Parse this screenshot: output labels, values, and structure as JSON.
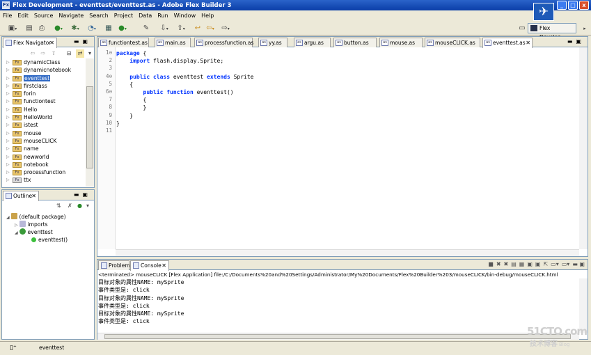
{
  "window": {
    "title": "Flex Development - eventtest/eventtest.as - Adobe Flex Builder 3",
    "app_icon": "Fx",
    "controls": [
      "_",
      "□",
      "x"
    ]
  },
  "menu": [
    "File",
    "Edit",
    "Source",
    "Navigate",
    "Search",
    "Project",
    "Data",
    "Run",
    "Window",
    "Help"
  ],
  "logo_glyph": "✈",
  "perspective": {
    "label": "Flex Develop..."
  },
  "navigator": {
    "tab_label": "Flex Navigator",
    "close": "✕",
    "items": [
      {
        "label": "dynamicClass"
      },
      {
        "label": "dynamicnotebook"
      },
      {
        "label": "eventtest",
        "selected": true
      },
      {
        "label": "firstclass"
      },
      {
        "label": "forin"
      },
      {
        "label": "functiontest"
      },
      {
        "label": "Hello"
      },
      {
        "label": "HelloWorld"
      },
      {
        "label": "istest"
      },
      {
        "label": "mouse"
      },
      {
        "label": "mouseCLICK"
      },
      {
        "label": "name"
      },
      {
        "label": "newworld"
      },
      {
        "label": "notebook"
      },
      {
        "label": "processfunction"
      },
      {
        "label": "ttx"
      }
    ]
  },
  "outline": {
    "tab_label": "Outline",
    "close": "✕",
    "nodes": [
      {
        "label": "(default package)"
      },
      {
        "label": "imports"
      },
      {
        "label": "eventtest"
      },
      {
        "label": "eventtest()"
      }
    ]
  },
  "editor": {
    "tabs": [
      {
        "label": "functiontest.as"
      },
      {
        "label": "main.as"
      },
      {
        "label": "processfunction.as"
      },
      {
        "label": "yy.as"
      },
      {
        "label": "argu.as"
      },
      {
        "label": "button.as"
      },
      {
        "label": "mouse.as"
      },
      {
        "label": "mouseCLICK.as"
      },
      {
        "label": "eventtest.as",
        "active": true
      }
    ],
    "line_numbers": [
      "1",
      "2",
      "3",
      "4",
      "5",
      "6",
      "7",
      "8",
      "9",
      "10",
      "11"
    ],
    "fold_markers": {
      "1": "⊖",
      "4": "⊖",
      "6": "⊖"
    },
    "code": [
      {
        "kw": "package",
        "rest": " {"
      },
      {
        "indent": "    ",
        "kw": "import",
        "rest": " flash.display.Sprite;"
      },
      {
        "rest": ""
      },
      {
        "indent": "    ",
        "kw": "public class",
        "rest": " eventtest ",
        "kw2": "extends",
        "rest2": " Sprite"
      },
      {
        "indent": "    ",
        "rest": "{"
      },
      {
        "indent": "        ",
        "kw": "public function",
        "rest": " eventtest()"
      },
      {
        "indent": "        ",
        "rest": "{"
      },
      {
        "indent": "        ",
        "rest": "}"
      },
      {
        "indent": "    ",
        "rest": "}"
      },
      {
        "rest": "}"
      },
      {
        "rest": ""
      }
    ]
  },
  "console_panel": {
    "tabs": [
      {
        "label": "Problems"
      },
      {
        "label": "Console",
        "active": true
      }
    ],
    "close": "✕",
    "header": "<terminated> mouseCLICK [Flex Application] file:/C:/Documents%20and%20Settings/Administrator/My%20Documents/Flex%20Builder%203/mouseCLICK/bin-debug/mouseCLICK.html",
    "lines": [
      "目标对象的属性NAME: mySprite",
      "事件类型是: click",
      "目标对象的属性NAME: mySprite",
      "事件类型是: click",
      "目标对象的属性NAME: mySprite",
      "事件类型是: click"
    ]
  },
  "status": {
    "text": "eventtest"
  },
  "watermark": {
    "big": "51CTO.com",
    "small": "技术博客",
    "blog": "Blog"
  }
}
